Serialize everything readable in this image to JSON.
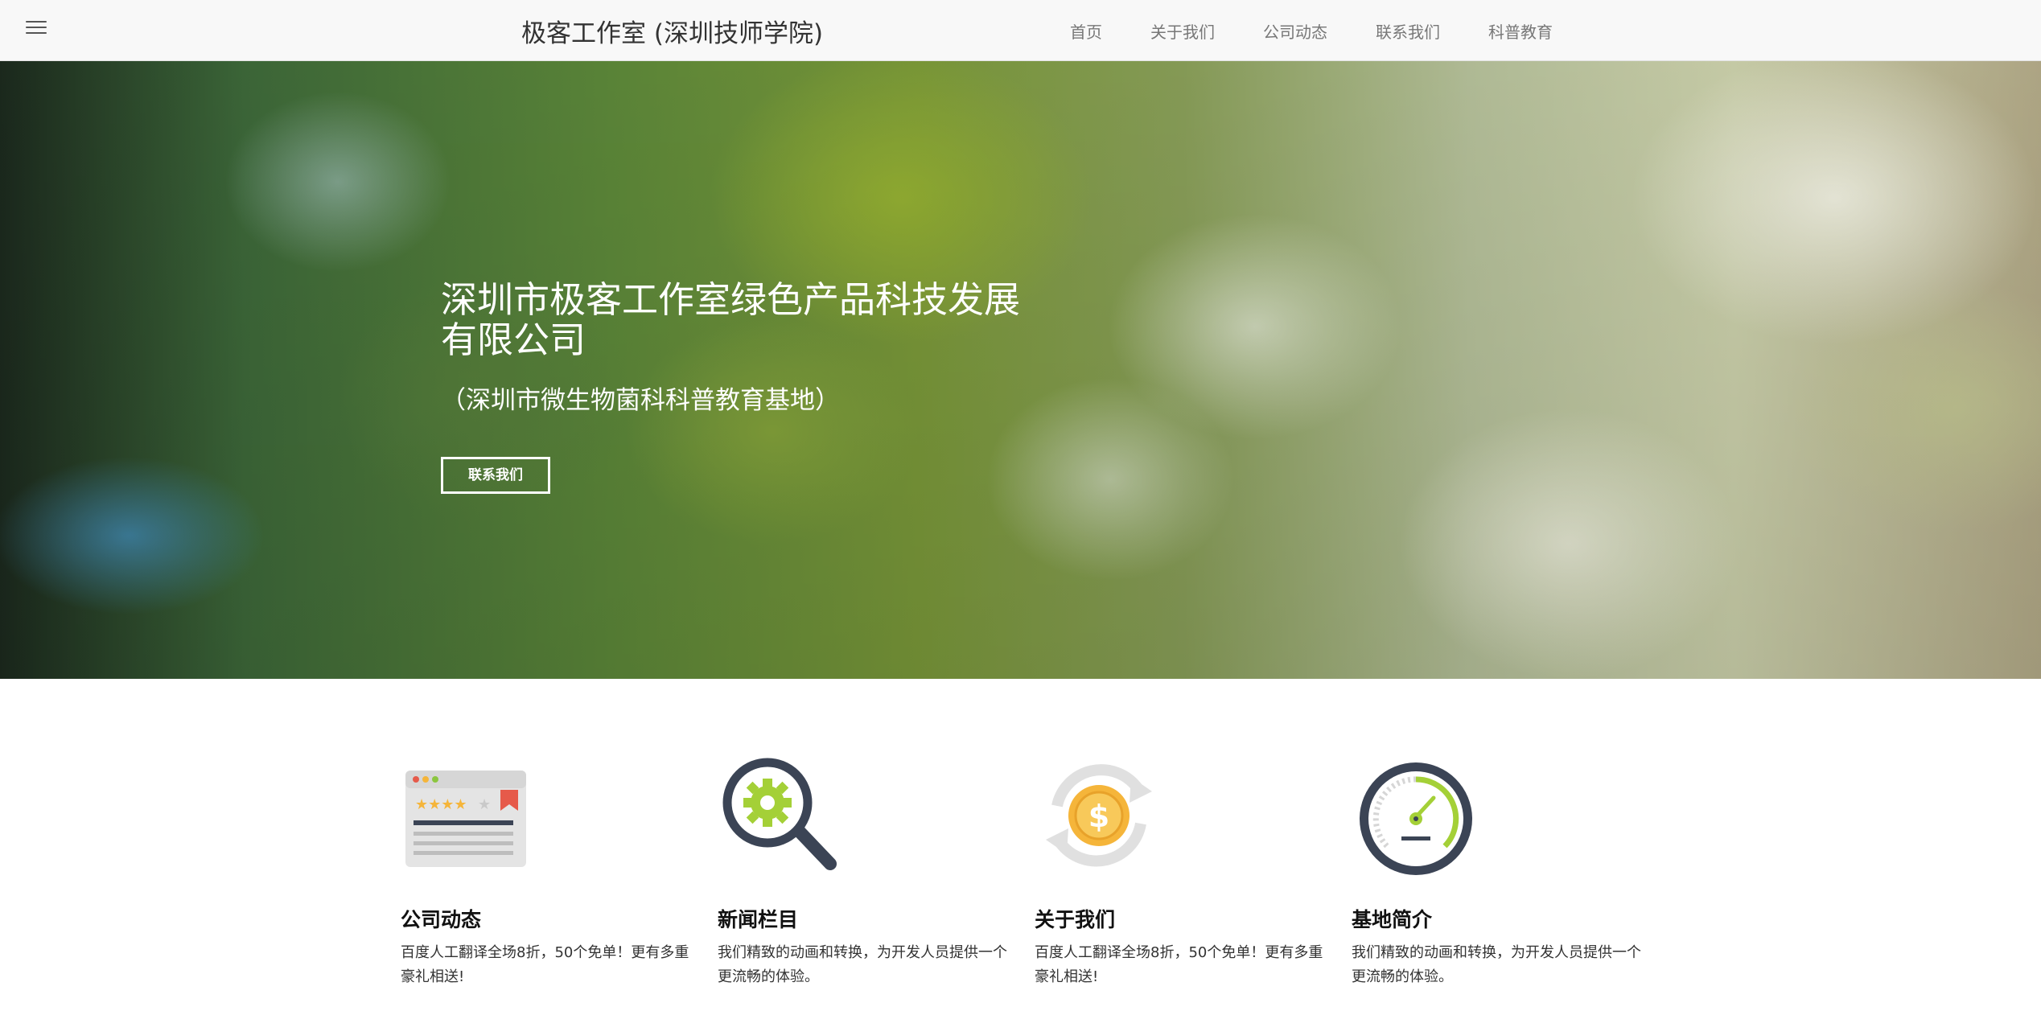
{
  "navbar": {
    "brand": "极客工作室 (深圳技师学院)",
    "links": [
      "首页",
      "关于我们",
      "公司动态",
      "联系我们",
      "科普教育"
    ]
  },
  "hero": {
    "title": "深圳市极客工作室绿色产品科技发展有限公司",
    "subtitle": "（深圳市微生物菌科科普教育基地）",
    "button_label": "联系我们"
  },
  "features": [
    {
      "icon": "rating-browser-icon",
      "title": "公司动态",
      "text": "百度人工翻译全场8折，50个免单！更有多重豪礼相送!"
    },
    {
      "icon": "magnifier-gear-icon",
      "title": "新闻栏目",
      "text": "我们精致的动画和转换，为开发人员提供一个更流畅的体验。"
    },
    {
      "icon": "coin-refresh-icon",
      "title": "关于我们",
      "text": "百度人工翻译全场8折，50个免单！更有多重豪礼相送!"
    },
    {
      "icon": "speedometer-icon",
      "title": "基地简介",
      "text": "我们精致的动画和转换，为开发人员提供一个更流畅的体验。"
    }
  ],
  "colors": {
    "navbar_bg": "#f8f8f8",
    "icon_dark": "#3b4455",
    "icon_green": "#a4d037",
    "icon_gold": "#f5b53a"
  }
}
